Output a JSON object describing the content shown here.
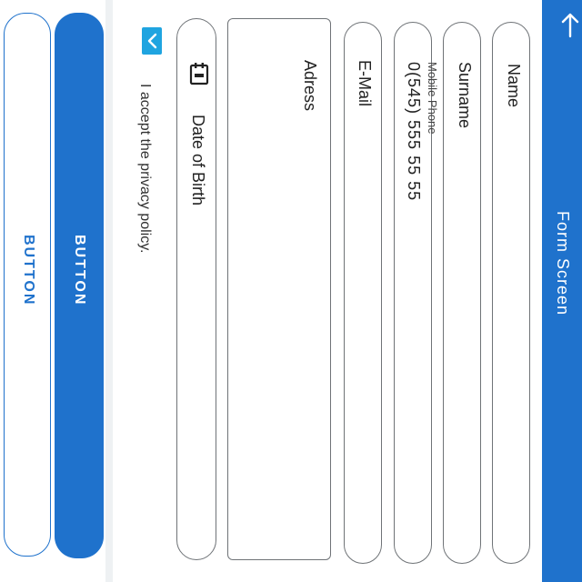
{
  "header": {
    "title": "Form Screen",
    "back_icon": "arrow-up-icon"
  },
  "form": {
    "name_label": "Name",
    "surname_label": "Surname",
    "phone_caption": "Mobile Phone",
    "phone_value": "0(545) 555 55 55",
    "email_label": "E-Mail",
    "address_label": "Adress",
    "dob_label": "Date of Birth",
    "dob_icon": "calendar-icon"
  },
  "privacy": {
    "label": "I accept the privacy policy.",
    "checked": true,
    "check_icon": "checkmark-icon"
  },
  "actions": {
    "primary_label": "BUTTON",
    "secondary_label": "BUTTON"
  },
  "colors": {
    "primary": "#1f72cc",
    "checkbox": "#1fa4e0",
    "border": "#6f7377"
  }
}
